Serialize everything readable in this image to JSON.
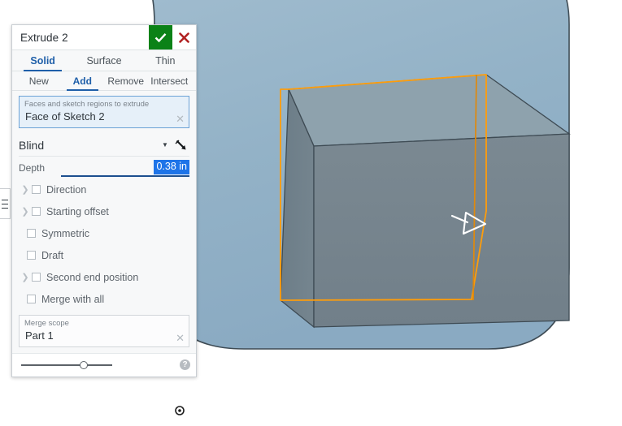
{
  "dialog": {
    "title": "Extrude 2",
    "confirm_icon": "check-icon",
    "cancel_icon": "close-icon",
    "primary_tabs": [
      {
        "label": "Solid",
        "active": true
      },
      {
        "label": "Surface",
        "active": false
      },
      {
        "label": "Thin",
        "active": false
      }
    ],
    "secondary_tabs": [
      {
        "label": "New",
        "active": false
      },
      {
        "label": "Add",
        "active": true
      },
      {
        "label": "Remove",
        "active": false
      },
      {
        "label": "Intersect",
        "active": false
      }
    ],
    "faces_field": {
      "label": "Faces and sketch regions to extrude",
      "value": "Face of Sketch 2",
      "clear_icon": "close-icon"
    },
    "end_type": {
      "value": "Blind",
      "caret_icon": "chevron-down-icon",
      "flip_icon": "flip-direction-arrow-icon"
    },
    "depth": {
      "label": "Depth",
      "value": "0.38 in",
      "selected": true
    },
    "options": [
      {
        "label": "Direction",
        "checked": false,
        "expandable": true
      },
      {
        "label": "Starting offset",
        "checked": false,
        "expandable": true
      },
      {
        "label": "Symmetric",
        "checked": false,
        "expandable": false
      },
      {
        "label": "Draft",
        "checked": false,
        "expandable": false
      },
      {
        "label": "Second end position",
        "checked": false,
        "expandable": true
      },
      {
        "label": "Merge with all",
        "checked": false,
        "expandable": false
      }
    ],
    "merge_scope": {
      "label": "Merge scope",
      "value": "Part 1",
      "clear_icon": "close-icon"
    },
    "footer": {
      "slider_name": "opacity-slider",
      "help_label": "?"
    }
  },
  "viewport": {
    "panel_tab_icon": "hamburger-icon",
    "origin_icon": "origin-target-icon",
    "colors": {
      "canvas": "#ffffff",
      "part_fill": "#94b3c8",
      "part_edge": "#3b4850",
      "cube_front": "#76848d",
      "cube_left": "#6b7c87",
      "cube_top": "#8fa3ae",
      "sketch_highlight": "#ff9d0a",
      "manipulator": "#ffffff"
    }
  }
}
